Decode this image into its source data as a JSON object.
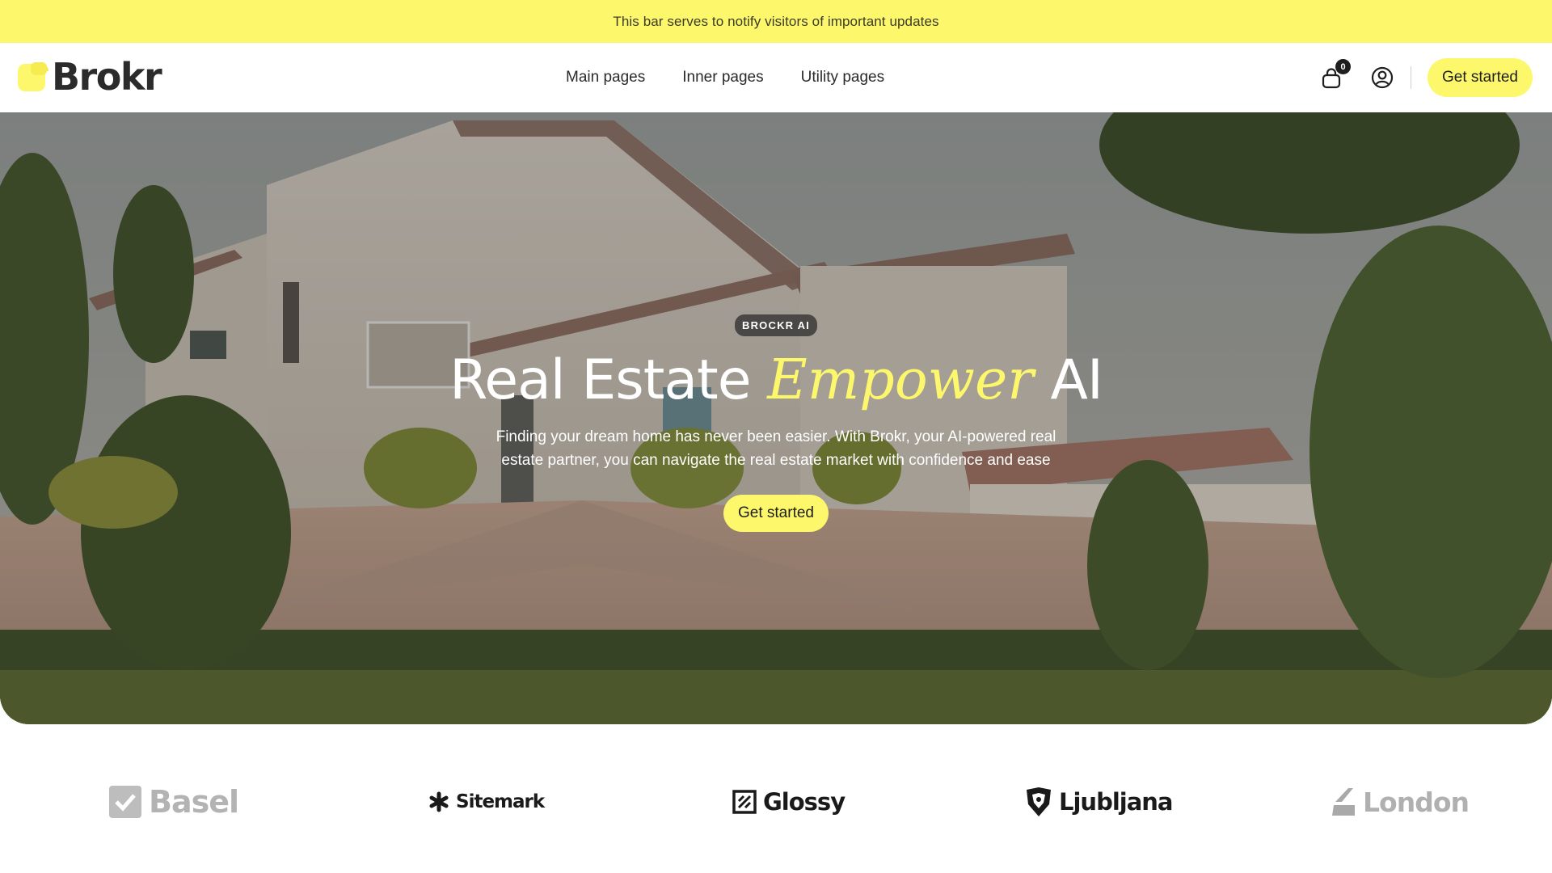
{
  "announcement": {
    "text": "This bar serves to notify visitors of important updates"
  },
  "header": {
    "logo_text": "Brokr",
    "nav": [
      {
        "label": "Main pages"
      },
      {
        "label": "Inner pages"
      },
      {
        "label": "Utility pages"
      }
    ],
    "cart_count": "0",
    "cta_label": "Get started",
    "icons": {
      "cart": "shopping-bag-icon",
      "user": "user-circle-icon"
    }
  },
  "hero": {
    "tag": "BROCKR AI",
    "title_before": "Real Estate ",
    "title_emphasis": "Empower",
    "title_after": " AI",
    "subtitle": "Finding your dream home has never been easier. With Brokr, your AI-powered real estate partner, you can navigate the real estate market with confidence and ease",
    "cta_label": "Get started"
  },
  "brands": [
    {
      "name": "Basel"
    },
    {
      "name": "Sitemark"
    },
    {
      "name": "Glossy"
    },
    {
      "name": "Ljubljana"
    },
    {
      "name": "London"
    }
  ],
  "colors": {
    "accent": "#fdf76b",
    "text": "#1f1f1f",
    "dark_badge": "#1e1e1e"
  }
}
